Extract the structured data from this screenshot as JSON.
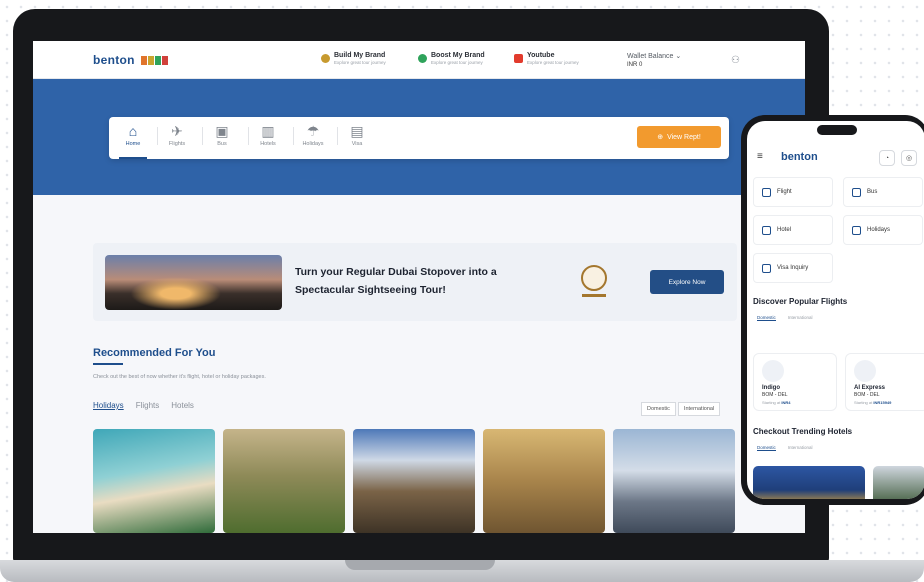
{
  "laptop": {
    "topnav": {
      "logo": "benton",
      "links": [
        {
          "title": "Build My Brand",
          "sub": "Explore great tour journey",
          "color": "#c79a2f"
        },
        {
          "title": "Boost My Brand",
          "sub": "Explore great tour journey",
          "color": "#2fa35b"
        },
        {
          "title": "Youtube",
          "sub": "Explore great tour journey",
          "color": "#e23b2d"
        }
      ],
      "wallet_label": "Wallet Balance",
      "wallet_value": "INR 0"
    },
    "search_tabs": [
      "Home",
      "Flights",
      "Bus",
      "Hotels",
      "Holidays",
      "Visa"
    ],
    "view_button": "View Rept!",
    "promo": {
      "text": "Turn your Regular Dubai Stopover into a Spectacular Sightseeing Tour!",
      "button": "Explore Now"
    },
    "recommended": {
      "title": "Recommended For You",
      "subtitle": "Check out the best of now whether it's flight, hotel or holiday packages.",
      "tabs": [
        "Holidays",
        "Flights",
        "Hotels"
      ],
      "scope": [
        "Domestic",
        "International"
      ]
    }
  },
  "phone": {
    "logo": "benton",
    "tiles": [
      "Flight",
      "Bus",
      "Hotel",
      "Holidays",
      "Visa Inquiry"
    ],
    "flights_heading": "Discover Popular Flights",
    "flights_tabs": [
      "Domestic",
      "International"
    ],
    "flights": [
      {
        "name": "Indigo",
        "route": "BOM - DEL",
        "price_label": "Starting at",
        "price": "INR4"
      },
      {
        "name": "AI Express",
        "route": "BOM - DEL",
        "price_label": "Starting at",
        "price": "INR15949"
      }
    ],
    "hotels_heading": "Checkout Trending Hotels",
    "hotels_tabs": [
      "Domestic",
      "International"
    ]
  }
}
